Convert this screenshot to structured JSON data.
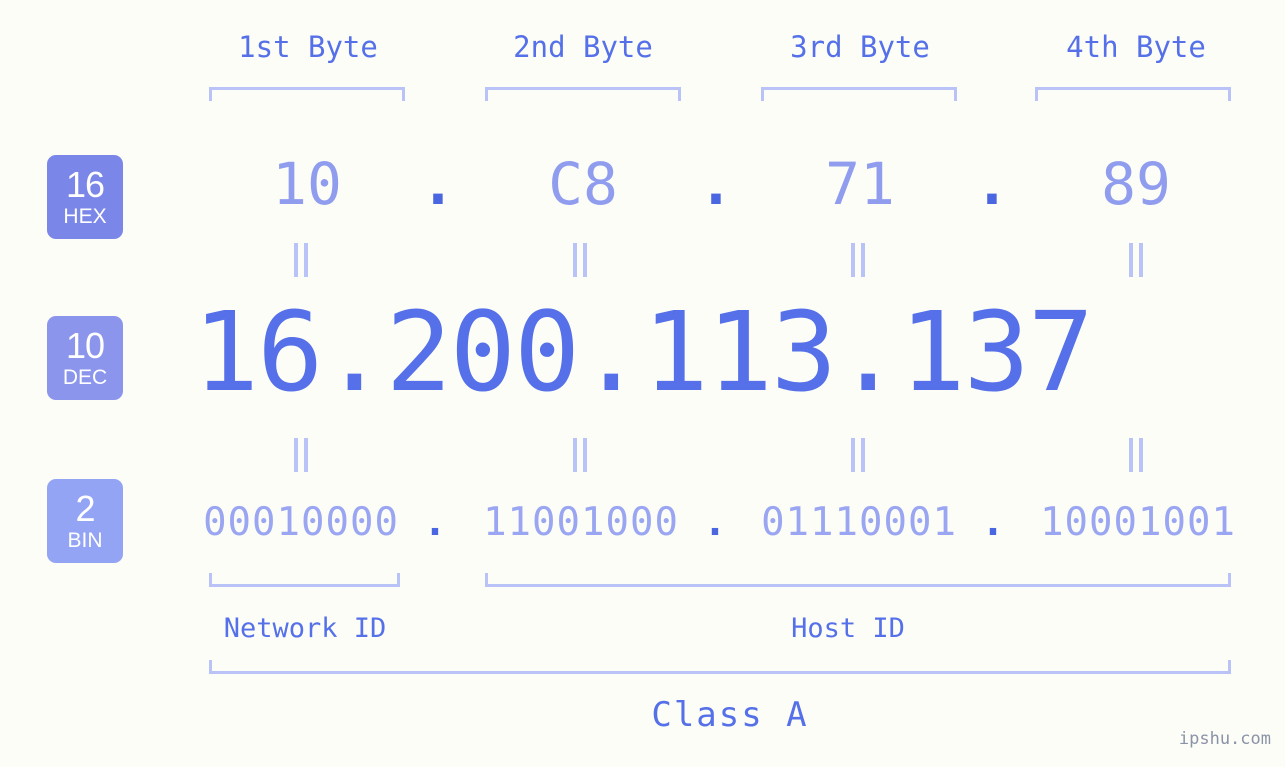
{
  "watermark": "ipshu.com",
  "byte_headers": [
    {
      "label": "1st Byte"
    },
    {
      "label": "2nd Byte"
    },
    {
      "label": "3rd Byte"
    },
    {
      "label": "4th Byte"
    }
  ],
  "bases": [
    {
      "num": "16",
      "name": "HEX",
      "color": "#7b87e8"
    },
    {
      "num": "10",
      "name": "DEC",
      "color": "#8b95ec"
    },
    {
      "num": "2",
      "name": "BIN",
      "color": "#93a4f5"
    }
  ],
  "rows": {
    "hex": {
      "base_num": "16",
      "base_name": "HEX",
      "values": [
        "10",
        "C8",
        "71",
        "89"
      ],
      "separator": "."
    },
    "dec": {
      "base_num": "10",
      "base_name": "DEC",
      "values": [
        "16",
        "200",
        "113",
        "137"
      ],
      "separator": ".",
      "full": "16.200.113.137"
    },
    "bin": {
      "base_num": "2",
      "base_name": "BIN",
      "values": [
        "00010000",
        "11001000",
        "01110001",
        "10001001"
      ],
      "separator": "."
    }
  },
  "connectors": {
    "symbol": "equals-rotated",
    "count_per_row": 4
  },
  "id_sections": [
    {
      "label": "Network ID"
    },
    {
      "label": "Host ID"
    }
  ],
  "class_section": {
    "label": "Class A"
  },
  "colors": {
    "background": "#fcfdf7",
    "bracket": "#b9c3f7",
    "hex_text": "#909dee",
    "dec_text": "#5570e8",
    "bin_text": "#9aa6f2",
    "dot": "#4a66e0",
    "header_text": "#5570e8",
    "watermark_text": "#8b93a8"
  }
}
